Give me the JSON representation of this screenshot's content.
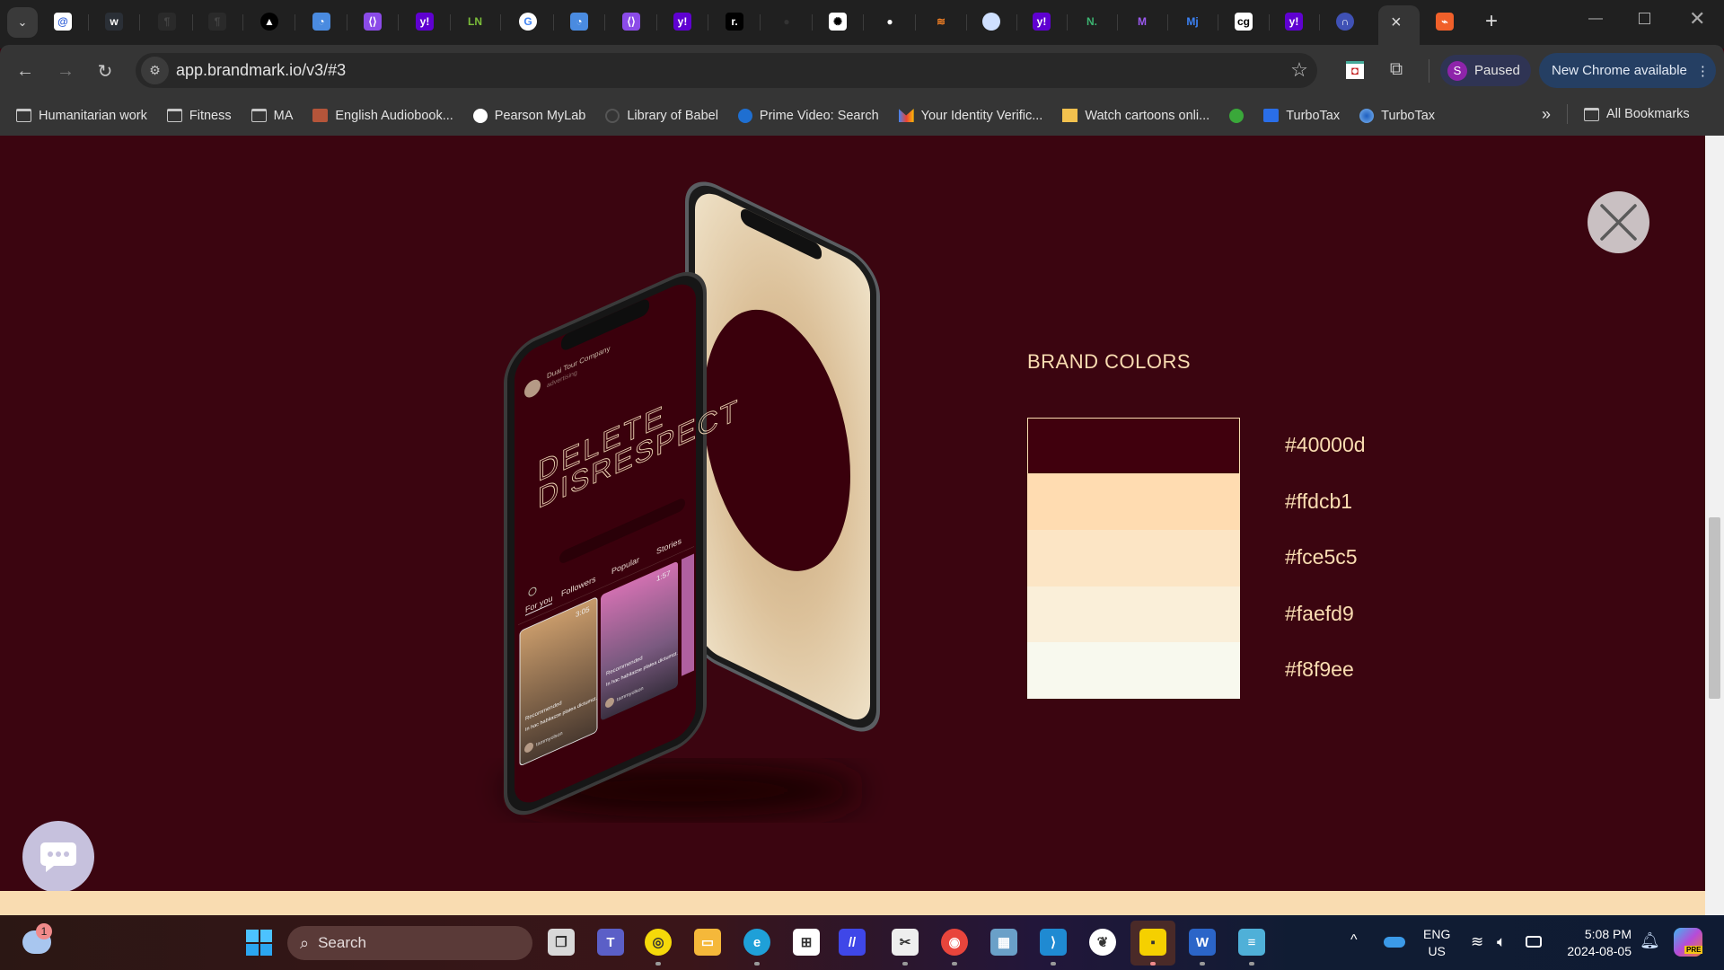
{
  "browser": {
    "tabs": [
      {
        "icon": "at-icon",
        "color": "#ffffff",
        "fg": "#2a5bd7",
        "glyph": "@"
      },
      {
        "icon": "webflow-icon",
        "color": "#2a2f36",
        "fg": "#ffffff",
        "glyph": "w"
      },
      {
        "icon": "dark-site-icon",
        "color": "#2a2a2a",
        "fg": "#444",
        "glyph": "¶"
      },
      {
        "icon": "dark-site-icon",
        "color": "#2a2a2a",
        "fg": "#444",
        "glyph": "¶"
      },
      {
        "icon": "triangle-logo-icon",
        "color": "#000000",
        "fg": "#ffffff",
        "glyph": "▲"
      },
      {
        "icon": "presentation-icon",
        "color": "#4a8be0",
        "fg": "#ffffff",
        "glyph": "◔"
      },
      {
        "icon": "purple-link-icon",
        "color": "#8b4be8",
        "fg": "#ffffff",
        "glyph": "⟨⟩"
      },
      {
        "icon": "yahoo-icon",
        "color": "#5f01d1",
        "fg": "#ffffff",
        "glyph": "y!"
      },
      {
        "icon": "ln-icon",
        "color": "#202020",
        "fg": "#7cbf3a",
        "glyph": "LN"
      },
      {
        "icon": "google-icon",
        "color": "#ffffff",
        "fg": "#4285f4",
        "glyph": "G"
      },
      {
        "icon": "presentation-icon",
        "color": "#4a8be0",
        "fg": "#ffffff",
        "glyph": "◔"
      },
      {
        "icon": "purple-link-icon",
        "color": "#8b4be8",
        "fg": "#ffffff",
        "glyph": "⟨⟩"
      },
      {
        "icon": "yahoo-icon",
        "color": "#5f01d1",
        "fg": "#ffffff",
        "glyph": "y!"
      },
      {
        "icon": "r-logo-icon",
        "color": "#000000",
        "fg": "#ffffff",
        "glyph": "r."
      },
      {
        "icon": "github-dark-icon",
        "color": "#202020",
        "fg": "#333",
        "glyph": "●"
      },
      {
        "icon": "openai-icon",
        "color": "#ffffff",
        "fg": "#000",
        "glyph": "✺"
      },
      {
        "icon": "github-icon",
        "color": "#202020",
        "fg": "#ffffff",
        "glyph": "●"
      },
      {
        "icon": "stackoverflow-icon",
        "color": "#202020",
        "fg": "#f48024",
        "glyph": "≋"
      },
      {
        "icon": "apple-icon",
        "color": "#cfe0ff",
        "fg": "#1a73e8",
        "glyph": ""
      },
      {
        "icon": "yahoo-icon",
        "color": "#5f01d1",
        "fg": "#ffffff",
        "glyph": "y!"
      },
      {
        "icon": "green-n-icon",
        "color": "#202020",
        "fg": "#3cb371",
        "glyph": "N."
      },
      {
        "icon": "m-logo-icon",
        "color": "#202020",
        "fg": "#9b59f0",
        "glyph": "M"
      },
      {
        "icon": "mj-logo-icon",
        "color": "#202020",
        "fg": "#3b82f6",
        "glyph": "Mj"
      },
      {
        "icon": "cg-icon",
        "color": "#ffffff",
        "fg": "#000",
        "glyph": "cg"
      },
      {
        "icon": "yahoo-icon",
        "color": "#5f01d1",
        "fg": "#ffffff",
        "glyph": "y!"
      },
      {
        "icon": "n-circle-icon",
        "color": "#3f51b5",
        "fg": "#ffffff",
        "glyph": "∩"
      }
    ],
    "active_tab_close": "×",
    "new_tab": "+",
    "url": "app.brandmark.io/v3/#3",
    "profile_initial": "S",
    "profile_status": "Paused",
    "update_label": "New Chrome available",
    "bookmarks": [
      {
        "label": "Humanitarian work",
        "icon": "folder"
      },
      {
        "label": "Fitness",
        "icon": "folder"
      },
      {
        "label": "MA",
        "icon": "folder"
      },
      {
        "label": "English Audiobook...",
        "icon": "audiobook"
      },
      {
        "label": "Pearson MyLab",
        "icon": "pearson"
      },
      {
        "label": "Library of Babel",
        "icon": "babel"
      },
      {
        "label": "Prime Video: Search",
        "icon": "prime"
      },
      {
        "label": "Your Identity Verific...",
        "icon": "gmail"
      },
      {
        "label": "Watch cartoons onli...",
        "icon": "cartoon"
      },
      {
        "label": "",
        "icon": "green-bolt"
      },
      {
        "label": "TurboTax",
        "icon": "turbotax"
      },
      {
        "label": "TurboTax",
        "icon": "turbotax-circle"
      }
    ],
    "more_bookmarks": "»",
    "all_bookmarks": "All Bookmarks"
  },
  "page": {
    "section_title": "BRAND COLORS",
    "colors": [
      "#40000d",
      "#ffdcb1",
      "#fce5c5",
      "#faefd9",
      "#f8f9ee"
    ],
    "phone": {
      "company": "Duai Tour Company",
      "company_sub": "advertising",
      "headline_1": "DELETE",
      "headline_2": "DISRESPECT",
      "tabs": [
        "For you",
        "Followers",
        "Popular",
        "Stories"
      ],
      "cards": [
        {
          "time": "3:05",
          "tag": "Recommended",
          "text": "In hac habitasse platea dictumst.",
          "user": "tammyolson"
        },
        {
          "time": "1:57",
          "tag": "Recommended",
          "text": "In hac habitasse platea dictumst.",
          "user": "tammyolson"
        }
      ]
    }
  },
  "taskbar": {
    "weather_badge": "1",
    "search_placeholder": "Search",
    "lang_1": "ENG",
    "lang_2": "US",
    "time": "5:08 PM",
    "date": "2024-08-05",
    "copilot_badge": "PRE"
  }
}
